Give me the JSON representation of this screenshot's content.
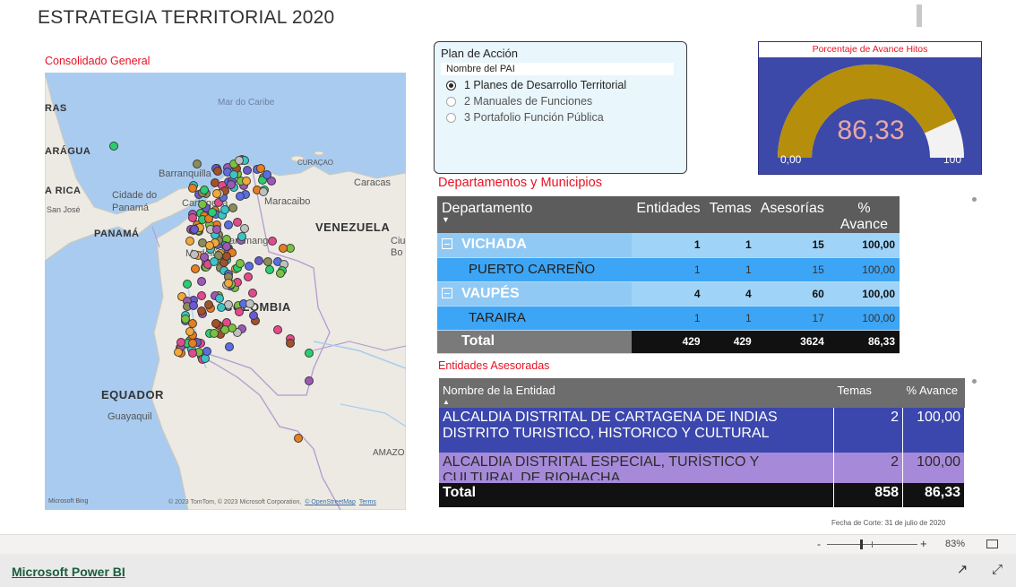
{
  "report": {
    "title": "ESTRATEGIA TERRITORIAL 2020"
  },
  "map": {
    "title": "Consolidado General",
    "labels": {
      "caribbean": "Mar do Caribe",
      "ras": "RAS",
      "nicaragua": "ARÁGUA",
      "costa_rica": "A RICA",
      "san_jose": "San José",
      "panama_city": "Cidade do Panamá",
      "panama": "PANAMÁ",
      "barranquilla": "Barranquilla",
      "curacao": "CURAÇAO",
      "caracas": "Caracas",
      "maracaibo": "Maracaibo",
      "cartagena": "Cartagena",
      "venezuela": "VENEZUELA",
      "bucaramanga": "Bucaramanga",
      "ciudad_bolivar": "Ciu Bo",
      "medellin": "Medellín",
      "colombia": "COLOMBIA",
      "ecuador": "EQUADOR",
      "guayaquil": "Guayaquil",
      "amazonas": "AMAZO"
    },
    "attribution": "© 2023 TomTom, © 2023 Microsoft Corporation,",
    "attribution_osm": "© OpenStreetMap",
    "attribution_terms": "Terms",
    "bing": "Microsoft Bing",
    "point_colors": [
      "#7ac143",
      "#e04b8c",
      "#5b6ee1",
      "#f2a93b",
      "#3cc4c4",
      "#9b59b6",
      "#8c8c5a",
      "#e67e22",
      "#2ecc71",
      "#a0522d",
      "#c0c0c0",
      "#6a5acd"
    ]
  },
  "slicer": {
    "title": "Plan de Acción",
    "header": "Nombre del PAI",
    "options": [
      {
        "label": "1 Planes de Desarrollo Territorial",
        "selected": true
      },
      {
        "label": "2 Manuales de Funciones",
        "selected": false
      },
      {
        "label": "3 Portafolio Función Pública",
        "selected": false
      }
    ]
  },
  "gauge": {
    "title": "Porcentaje de Avance Hitos",
    "value": "86,33",
    "min": "0,00",
    "max": "100",
    "fraction": 0.8633,
    "fill_color": "#b58e0b",
    "track_color": "#f2f2f2",
    "background_color": "#3d49a8"
  },
  "departments": {
    "title": "Departamentos y Municipios",
    "columns": [
      "Departamento",
      "Entidades",
      "Temas",
      "Asesorías",
      "% Avance"
    ],
    "rows": [
      {
        "level": 1,
        "name": "VICHADA",
        "entidades": "1",
        "temas": "1",
        "asesorias": "15",
        "avance": "100,00"
      },
      {
        "level": 2,
        "name": "PUERTO CARREÑO",
        "entidades": "1",
        "temas": "1",
        "asesorias": "15",
        "avance": "100,00"
      },
      {
        "level": 1,
        "name": "VAUPÉS",
        "entidades": "4",
        "temas": "4",
        "asesorias": "60",
        "avance": "100,00"
      },
      {
        "level": 2,
        "name": "TARAIRA",
        "entidades": "1",
        "temas": "1",
        "asesorias": "17",
        "avance": "100,00"
      }
    ],
    "total": {
      "name": "Total",
      "entidades": "429",
      "temas": "429",
      "asesorias": "3624",
      "avance": "86,33"
    }
  },
  "entities": {
    "title": "Entidades Asesoradas",
    "columns": [
      "Nombre de la Entidad",
      "Temas",
      "% Avance"
    ],
    "rows": [
      {
        "name": "ALCALDIA DISTRITAL DE CARTAGENA DE INDIAS DISTRITO TURISTICO, HISTORICO Y CULTURAL",
        "temas": "2",
        "avance": "100,00"
      },
      {
        "name": "ALCALDIA DISTRITAL ESPECIAL, TURÍSTICO Y CULTURAL DE RIOHACHA",
        "temas": "2",
        "avance": "100,00"
      }
    ],
    "total": {
      "name": "Total",
      "temas": "858",
      "avance": "86,33"
    }
  },
  "cutoff_date": "Fecha de Corte: 31 de julio de 2020",
  "zoom": {
    "minus": "-",
    "plus": "+",
    "percent": "83%"
  },
  "footer": {
    "brand": "Microsoft Power BI"
  }
}
